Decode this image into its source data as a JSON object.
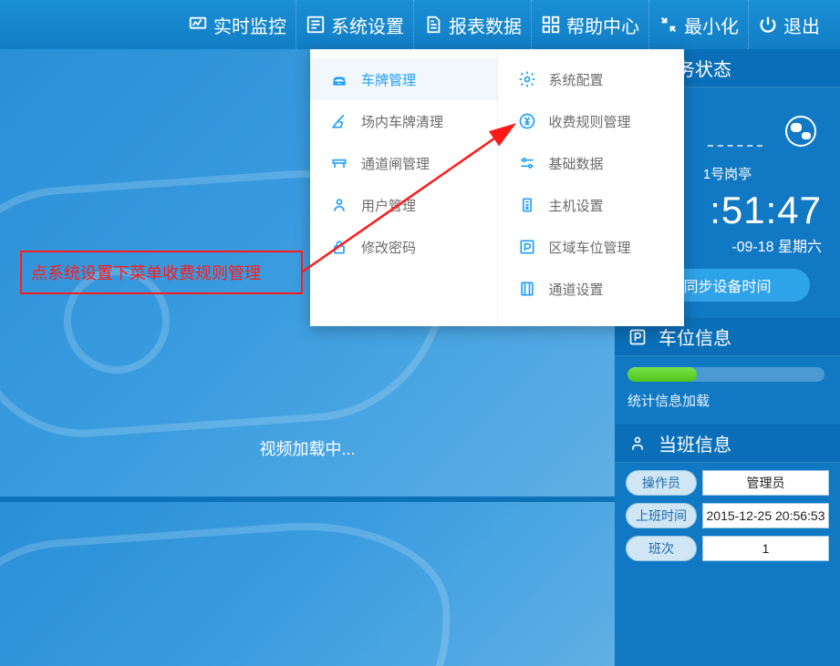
{
  "topbar": {
    "items": [
      {
        "label": "实时监控"
      },
      {
        "label": "系统设置"
      },
      {
        "label": "报表数据"
      },
      {
        "label": "帮助中心"
      },
      {
        "label": "最小化"
      },
      {
        "label": "退出"
      }
    ]
  },
  "dropdown": {
    "left": [
      {
        "label": "车牌管理",
        "active": true
      },
      {
        "label": "场内车牌清理"
      },
      {
        "label": "通道闸管理"
      },
      {
        "label": "用户管理"
      },
      {
        "label": "修改密码"
      }
    ],
    "right": [
      {
        "label": "系统配置"
      },
      {
        "label": "收费规则管理"
      },
      {
        "label": "基础数据"
      },
      {
        "label": "主机设置"
      },
      {
        "label": "区域车位管理"
      },
      {
        "label": "通道设置"
      }
    ]
  },
  "annotation": "点系统设置下菜单收费规则管理",
  "video_loading": "视频加载中...",
  "status": {
    "title": "服务状态",
    "station": "1号岗亭",
    "time": ":51:47",
    "date": "-09-18 星期六",
    "sync_btn": "同步设备时间"
  },
  "park": {
    "title": "车位信息",
    "progress_pct": 35,
    "stats_text": "统计信息加载"
  },
  "duty": {
    "title": "当班信息",
    "rows": [
      {
        "label": "操作员",
        "value": "管理员"
      },
      {
        "label": "上班时间",
        "value": "2015-12-25 20:56:53"
      },
      {
        "label": "班次",
        "value": "1"
      }
    ]
  }
}
